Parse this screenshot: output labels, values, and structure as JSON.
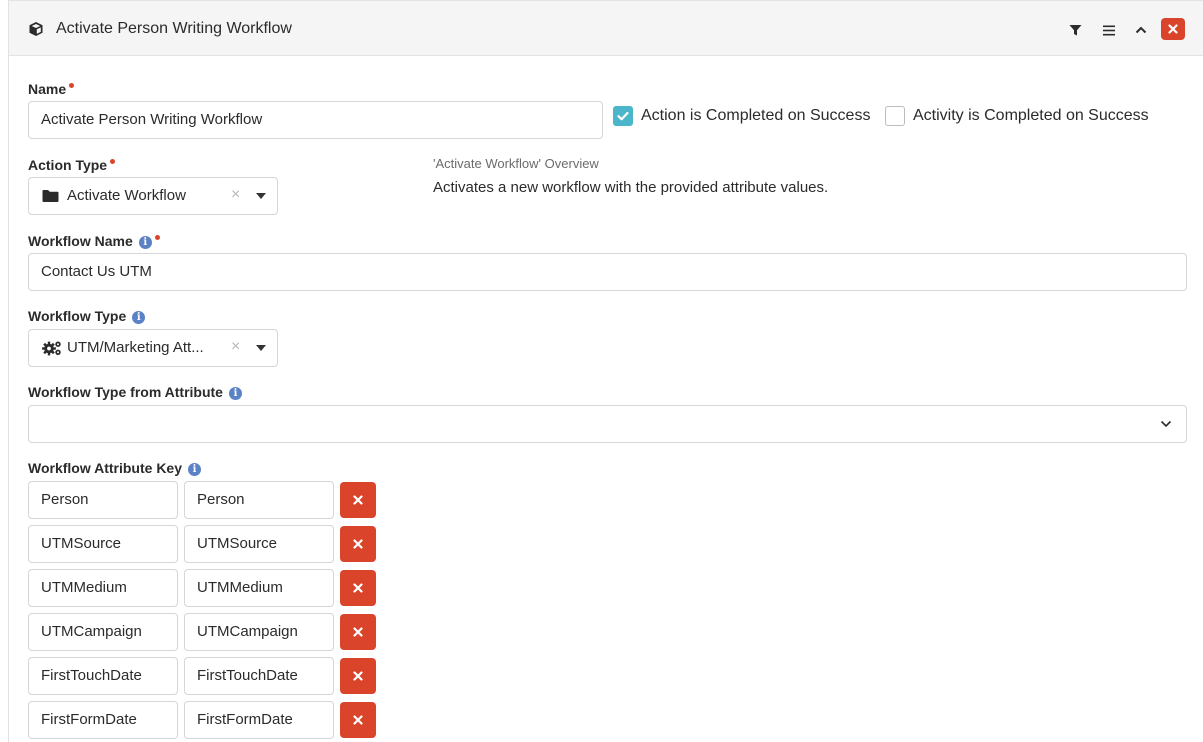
{
  "header": {
    "title": "Activate Person Writing Workflow"
  },
  "name": {
    "label": "Name",
    "value": "Activate Person Writing Workflow"
  },
  "checkboxes": {
    "action_completed": {
      "label": "Action is Completed on Success",
      "checked": true
    },
    "activity_completed": {
      "label": "Activity is Completed on Success",
      "checked": false
    }
  },
  "action_type": {
    "label": "Action Type",
    "value": "Activate Workflow",
    "clear": "×"
  },
  "overview": {
    "title": "'Activate Workflow' Overview",
    "text": "Activates a new workflow with the provided attribute values."
  },
  "workflow_name": {
    "label": "Workflow Name",
    "value": "Contact Us UTM"
  },
  "workflow_type": {
    "label": "Workflow Type",
    "value": "UTM/Marketing Att...",
    "clear": "×"
  },
  "workflow_type_from_attribute": {
    "label": "Workflow Type from Attribute",
    "value": ""
  },
  "attribute_key": {
    "label": "Workflow Attribute Key",
    "rows": [
      {
        "key": "Person",
        "value": "Person"
      },
      {
        "key": "UTMSource",
        "value": "UTMSource"
      },
      {
        "key": "UTMMedium",
        "value": "UTMMedium"
      },
      {
        "key": "UTMCampaign",
        "value": "UTMCampaign"
      },
      {
        "key": "FirstTouchDate",
        "value": "FirstTouchDate"
      },
      {
        "key": "FirstFormDate",
        "value": "FirstFormDate"
      }
    ]
  },
  "colors": {
    "accent_check": "#4bb6c9",
    "danger": "#d9442b",
    "info": "#5b82c4"
  },
  "icons": {
    "title": "cube-icon",
    "filter": "filter-icon",
    "menu": "menu-icon",
    "collapse": "chevron-up-icon",
    "close": "close-icon",
    "folder": "folder-icon",
    "cogs": "cogs-icon",
    "info": "info-icon"
  }
}
